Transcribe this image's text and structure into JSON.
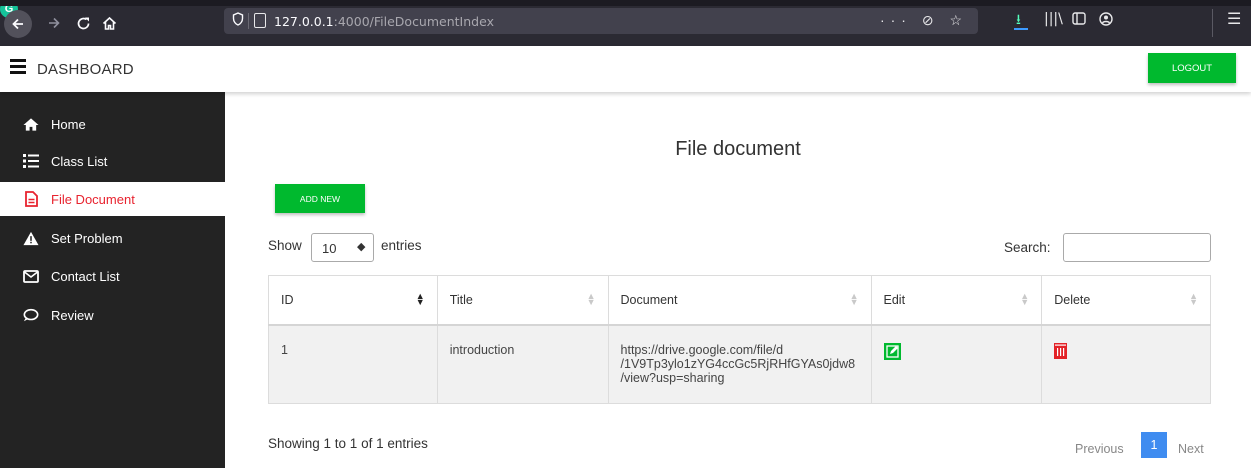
{
  "browser": {
    "url_host": "127.0.0.1",
    "url_rest": ":4000/FileDocumentIndex",
    "url_actions": "··· ⊘ ☆",
    "extension_letter": "G"
  },
  "header": {
    "title": "DASHBOARD",
    "logout_label": "LOGOUT"
  },
  "sidebar": {
    "items": [
      {
        "label": "Home",
        "icon": "home-icon"
      },
      {
        "label": "Class List",
        "icon": "list-icon"
      },
      {
        "label": "File Document",
        "icon": "file-icon",
        "active": true
      },
      {
        "label": "Set Problem",
        "icon": "warning-icon"
      },
      {
        "label": "Contact List",
        "icon": "envelope-icon"
      },
      {
        "label": "Review",
        "icon": "chat-icon"
      }
    ]
  },
  "main": {
    "title": "File document",
    "add_label": "ADD NEW",
    "show_label": "Show",
    "page_length": "10",
    "entries_label": "entries",
    "search_label": "Search:",
    "search_value": "",
    "columns": [
      "ID",
      "Title",
      "Document",
      "Edit",
      "Delete"
    ],
    "rows": [
      {
        "id": "1",
        "title": "introduction",
        "document_lines": [
          "https://drive.google.com/file/d",
          "/1V9Tp3ylo1zYG4ccGc5RjRHfGYAs0jdw8",
          "/view?usp=sharing"
        ]
      }
    ],
    "info": "Showing 1 to 1 of 1 entries",
    "pager": {
      "previous": "Previous",
      "current": "1",
      "next": "Next"
    }
  },
  "colors": {
    "accent_green": "#00b92e",
    "active_red": "#e8232f",
    "sidebar_bg": "#232323",
    "page_blue": "#3f8cf0"
  }
}
